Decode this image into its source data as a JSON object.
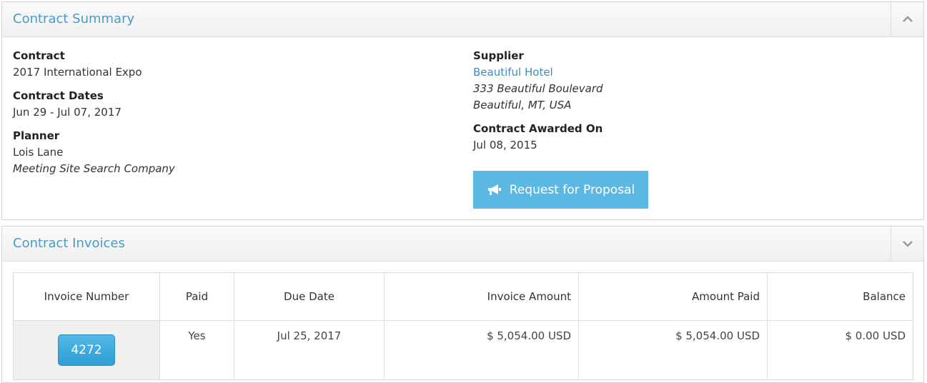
{
  "summary": {
    "title": "Contract Summary",
    "contract_label": "Contract",
    "contract_value": "2017 International Expo",
    "dates_label": "Contract Dates",
    "dates_value": "Jun 29 - Jul 07, 2017",
    "planner_label": "Planner",
    "planner_name": "Lois Lane",
    "planner_company": "Meeting Site Search Company",
    "supplier_label": "Supplier",
    "supplier_name": "Beautiful Hotel",
    "supplier_address1": "333 Beautiful Boulevard",
    "supplier_address2": "Beautiful, MT, USA",
    "awarded_label": "Contract Awarded On",
    "awarded_value": "Jul 08, 2015",
    "rfp_button": "Request for Proposal",
    "toggle_icon": "chevron-up-icon"
  },
  "invoices": {
    "title": "Contract Invoices",
    "toggle_icon": "chevron-down-icon",
    "columns": [
      "Invoice Number",
      "Paid",
      "Due Date",
      "Invoice Amount",
      "Amount Paid",
      "Balance"
    ],
    "rows": [
      {
        "invoice_number": "4272",
        "paid": "Yes",
        "due_date": "Jul 25, 2017",
        "invoice_amount": "$ 5,054.00 USD",
        "amount_paid": "$ 5,054.00 USD",
        "balance": "$ 0.00 USD"
      }
    ]
  },
  "colors": {
    "accent": "#4a9ac9",
    "button": "#5bb8e3"
  }
}
